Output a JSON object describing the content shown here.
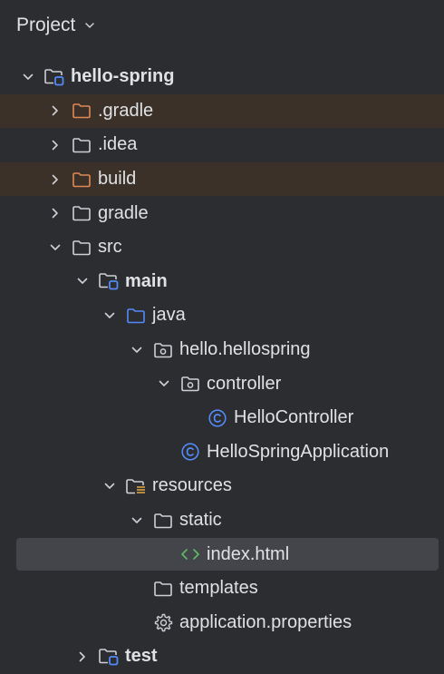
{
  "panel": {
    "title": "Project"
  },
  "tree": [
    {
      "id": "hello-spring",
      "label": "hello-spring",
      "depth": 0,
      "arrow": "down",
      "icon": "module-folder",
      "bold": true,
      "ignored": false,
      "selected": false
    },
    {
      "id": "gradle-dir",
      "label": ".gradle",
      "depth": 1,
      "arrow": "right",
      "icon": "folder-excluded",
      "bold": false,
      "ignored": true,
      "selected": false
    },
    {
      "id": "idea",
      "label": ".idea",
      "depth": 1,
      "arrow": "right",
      "icon": "folder",
      "bold": false,
      "ignored": false,
      "selected": false
    },
    {
      "id": "build",
      "label": "build",
      "depth": 1,
      "arrow": "right",
      "icon": "folder-excluded",
      "bold": false,
      "ignored": true,
      "selected": false
    },
    {
      "id": "gradle",
      "label": "gradle",
      "depth": 1,
      "arrow": "right",
      "icon": "folder",
      "bold": false,
      "ignored": false,
      "selected": false
    },
    {
      "id": "src",
      "label": "src",
      "depth": 1,
      "arrow": "down",
      "icon": "folder",
      "bold": false,
      "ignored": false,
      "selected": false
    },
    {
      "id": "main",
      "label": "main",
      "depth": 2,
      "arrow": "down",
      "icon": "module-folder",
      "bold": true,
      "ignored": false,
      "selected": false
    },
    {
      "id": "java",
      "label": "java",
      "depth": 3,
      "arrow": "down",
      "icon": "source-folder",
      "bold": false,
      "ignored": false,
      "selected": false
    },
    {
      "id": "pkg-hello",
      "label": "hello.hellospring",
      "depth": 4,
      "arrow": "down",
      "icon": "package",
      "bold": false,
      "ignored": false,
      "selected": false
    },
    {
      "id": "pkg-controller",
      "label": "controller",
      "depth": 5,
      "arrow": "down",
      "icon": "package",
      "bold": false,
      "ignored": false,
      "selected": false
    },
    {
      "id": "hello-controller",
      "label": "HelloController",
      "depth": 6,
      "arrow": "none",
      "icon": "class",
      "bold": false,
      "ignored": false,
      "selected": false
    },
    {
      "id": "hello-spring-app",
      "label": "HelloSpringApplication",
      "depth": 5,
      "arrow": "none",
      "icon": "class",
      "bold": false,
      "ignored": false,
      "selected": false
    },
    {
      "id": "resources",
      "label": "resources",
      "depth": 3,
      "arrow": "down",
      "icon": "resources-folder",
      "bold": false,
      "ignored": false,
      "selected": false
    },
    {
      "id": "static",
      "label": "static",
      "depth": 4,
      "arrow": "down",
      "icon": "folder",
      "bold": false,
      "ignored": false,
      "selected": false
    },
    {
      "id": "index-html",
      "label": "index.html",
      "depth": 5,
      "arrow": "none",
      "icon": "html-file",
      "bold": false,
      "ignored": false,
      "selected": true
    },
    {
      "id": "templates",
      "label": "templates",
      "depth": 4,
      "arrow": "none",
      "icon": "folder",
      "bold": false,
      "ignored": false,
      "selected": false
    },
    {
      "id": "app-props",
      "label": "application.properties",
      "depth": 4,
      "arrow": "none",
      "icon": "gear",
      "bold": false,
      "ignored": false,
      "selected": false
    },
    {
      "id": "test",
      "label": "test",
      "depth": 2,
      "arrow": "right",
      "icon": "module-folder",
      "bold": true,
      "ignored": false,
      "selected": false
    }
  ],
  "colors": {
    "background": "#2b2d30",
    "text": "#dfe1e5",
    "icon_gray": "#ced0d6",
    "excluded_orange": "#e08855",
    "module_blue": "#548af7",
    "html_green": "#5fb865",
    "ignored_row": "#3b3128",
    "selected_row": "#43454a"
  }
}
